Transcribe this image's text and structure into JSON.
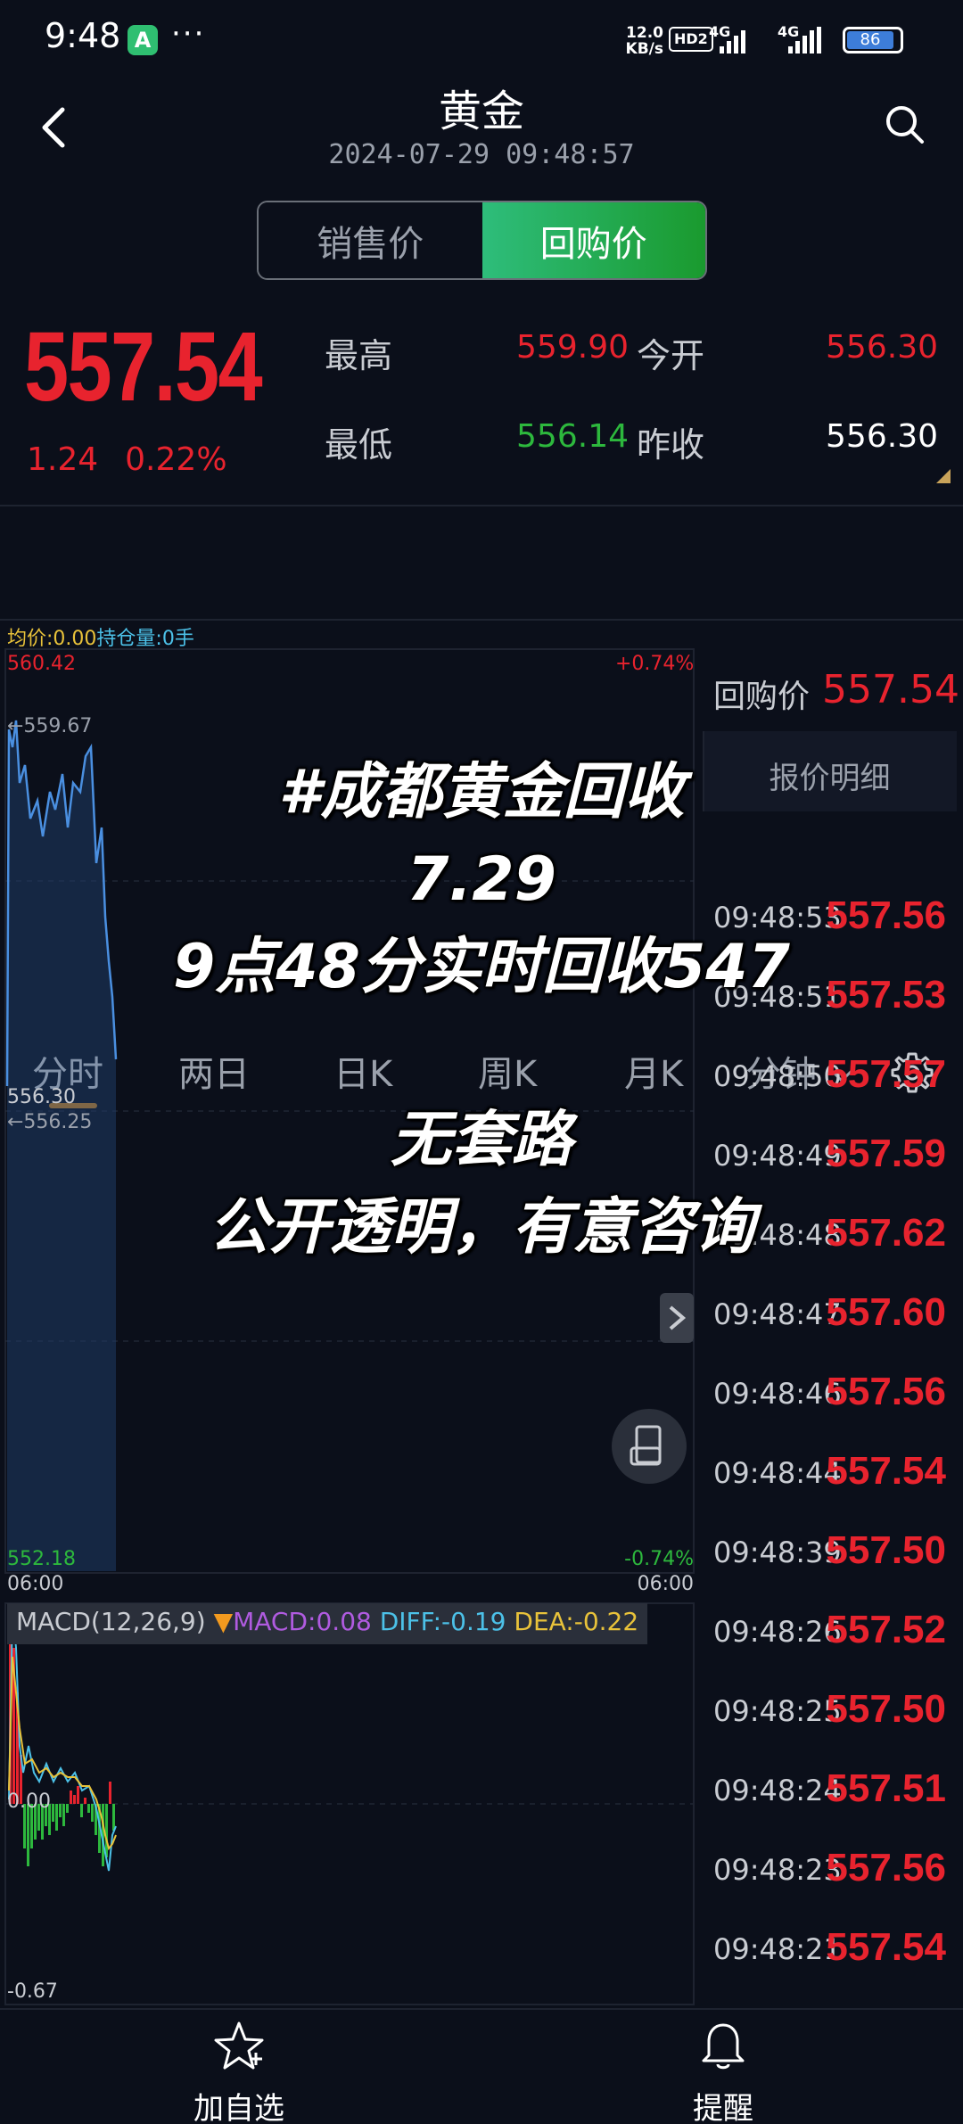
{
  "status_bar": {
    "time": "9:48",
    "app_icon_letter": "A",
    "more": "···",
    "net_speed_value": "12.0",
    "net_speed_unit": "KB/s",
    "hd": "HD2",
    "sig1_label": "4G",
    "sig2_label": "4G",
    "battery": "86"
  },
  "header": {
    "title": "黄金",
    "timestamp": "2024-07-29 09:48:57"
  },
  "segment": {
    "sell_label": "销售价",
    "buyback_label": "回购价",
    "active": "buyback"
  },
  "quote": {
    "price": "557.54",
    "change": "1.24",
    "change_pct": "0.22%",
    "high_label": "最高",
    "high_value": "559.90",
    "open_label": "今开",
    "open_value": "556.30",
    "low_label": "最低",
    "low_value": "556.14",
    "prev_close_label": "昨收",
    "prev_close_value": "556.30"
  },
  "tabs": {
    "items": [
      "分时",
      "两日",
      "日K",
      "周K",
      "月K",
      "分钟"
    ],
    "active_index": 0
  },
  "chart": {
    "avg_label": "均价:0.00",
    "position_label": "持仓量:0手",
    "top_price": "560.42",
    "top_pct": "+0.74%",
    "high_marker": "←559.67",
    "mid_price": "556.30",
    "low_marker": "←556.25",
    "bottom_price": "552.18",
    "bottom_pct": "-0.74%",
    "start_time": "06:00",
    "end_time": "06:00"
  },
  "macd": {
    "name": "MACD(12,26,9)",
    "macd": "MACD:0.08",
    "diff": "DIFF:-0.19",
    "dea": "DEA:-0.22",
    "zero_label": "0.00",
    "min_label": "-0.67",
    "colors": {
      "macd": "#b05be0",
      "diff": "#4cc1e8",
      "dea": "#e8c23a"
    }
  },
  "right_panel": {
    "buyback_label": "回购价",
    "buyback_value": "557.54",
    "detail_title": "报价明细",
    "ticks": [
      {
        "time": "09:48:53",
        "price": "557.56"
      },
      {
        "time": "09:48:51",
        "price": "557.53"
      },
      {
        "time": "09:48:50",
        "price": "557.57"
      },
      {
        "time": "09:48:49",
        "price": "557.59"
      },
      {
        "time": "09:48:48",
        "price": "557.62"
      },
      {
        "time": "09:48:47",
        "price": "557.60"
      },
      {
        "time": "09:48:46",
        "price": "557.56"
      },
      {
        "time": "09:48:44",
        "price": "557.54"
      },
      {
        "time": "09:48:39",
        "price": "557.50"
      },
      {
        "time": "09:48:26",
        "price": "557.52"
      },
      {
        "time": "09:48:25",
        "price": "557.50"
      },
      {
        "time": "09:48:24",
        "price": "557.51"
      },
      {
        "time": "09:48:23",
        "price": "557.56"
      },
      {
        "time": "09:48:21",
        "price": "557.54"
      }
    ]
  },
  "overlay_text": {
    "line1": "#成都黄金回收",
    "line2": "7.29",
    "line3": "9点48分实时回收547",
    "line4": "无套路",
    "line5": "公开透明，有意咨询"
  },
  "bottom_bar": {
    "watchlist_label": "加自选",
    "alert_label": "提醒"
  },
  "colors": {
    "up": "#e8232e",
    "down": "#2db83d",
    "accent": "#f29a1f",
    "line": "#4a8fe0"
  }
}
